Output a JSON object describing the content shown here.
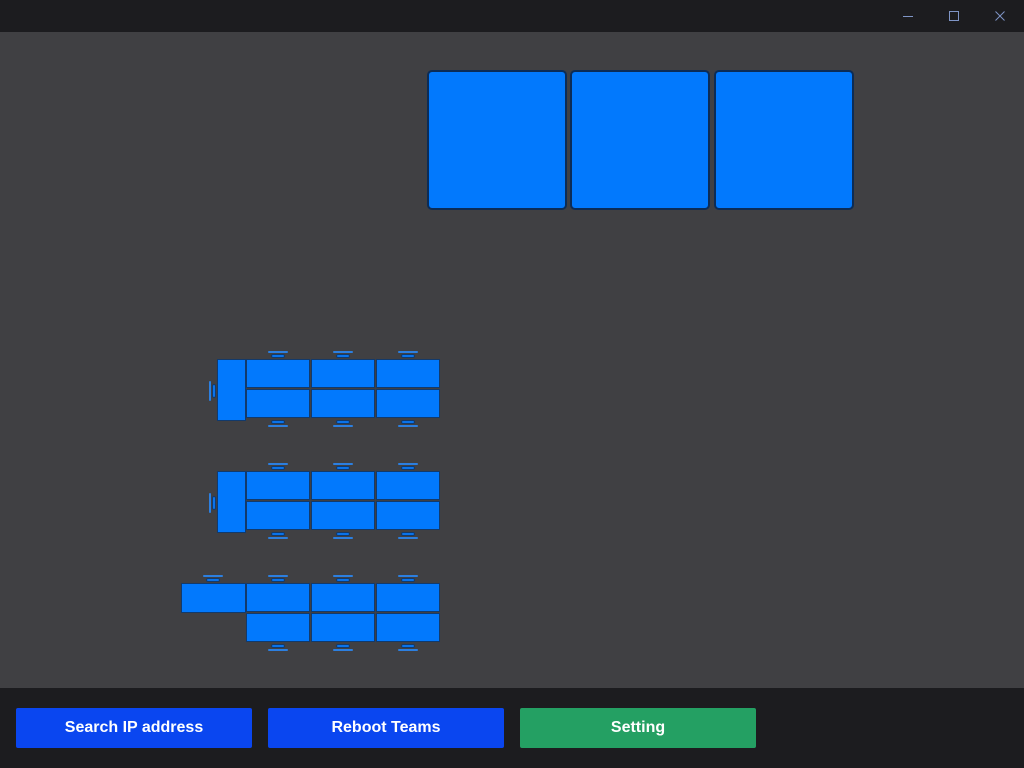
{
  "window_controls": [
    "minimize-icon",
    "maximize-icon",
    "close-icon"
  ],
  "colors": {
    "background": "#1c1c1f",
    "canvas": "#404043",
    "device_blue": "#0279fd",
    "button_blue": "#0a46f0",
    "button_green": "#24a063"
  },
  "room_layout": {
    "displays": 3,
    "table_rows": [
      {
        "seats": 6,
        "head": "end-seat",
        "left_chair": true
      },
      {
        "seats": 6,
        "head": "end-seat",
        "left_chair": true
      },
      {
        "seats": 6,
        "head": "side-seat",
        "left_chair": false
      }
    ]
  },
  "footer": {
    "search_ip_label": "Search IP address",
    "reboot_teams_label": "Reboot Teams",
    "setting_label": "Setting"
  }
}
